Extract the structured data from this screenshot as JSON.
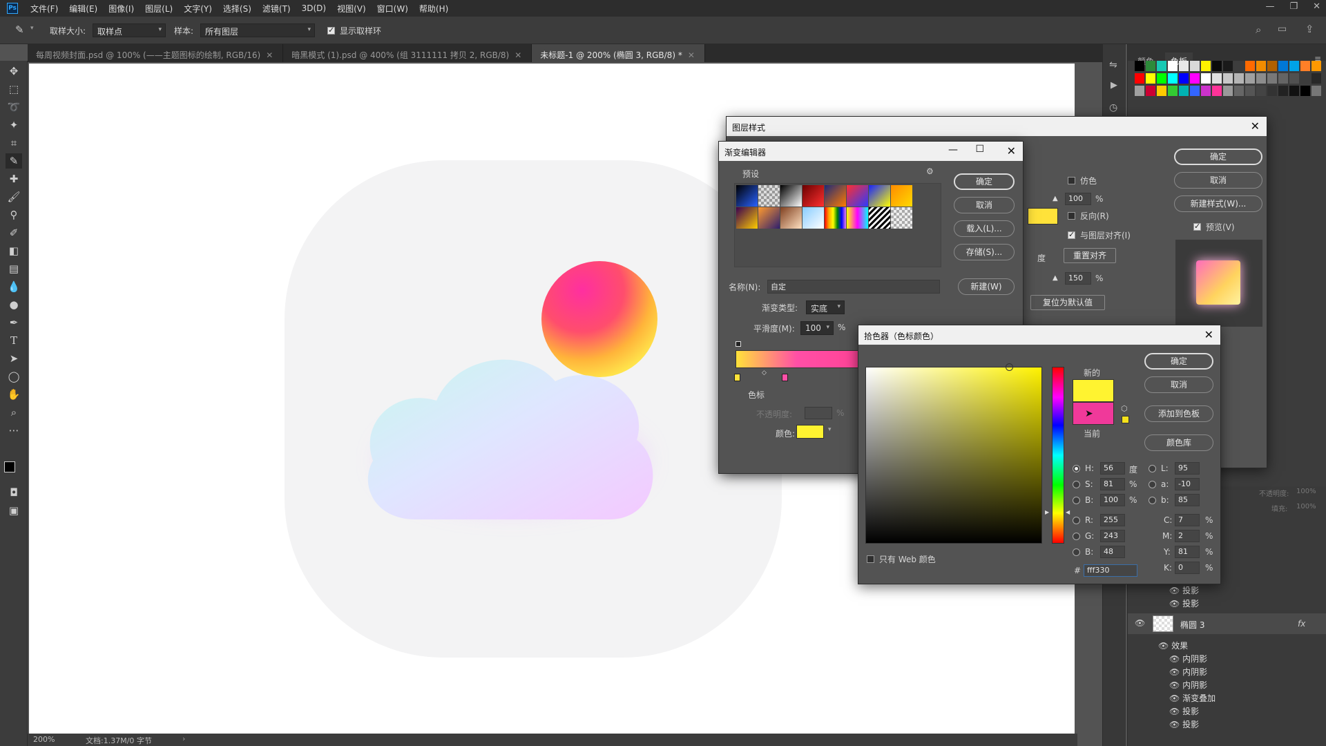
{
  "menubar": {
    "logo": "Ps",
    "items": [
      "文件(F)",
      "编辑(E)",
      "图像(I)",
      "图层(L)",
      "文字(Y)",
      "选择(S)",
      "滤镜(T)",
      "3D(D)",
      "视图(V)",
      "窗口(W)",
      "帮助(H)"
    ]
  },
  "options": {
    "sample_size_label": "取样大小:",
    "sample_size_value": "取样点",
    "sample_label": "样本:",
    "sample_value": "所有图层",
    "show_ring_label": "显示取样环"
  },
  "tabs": [
    {
      "label": "每周视频封面.psd @ 100% (——主题图标的绘制, RGB/16)",
      "active": false
    },
    {
      "label": "暗黑模式 (1).psd @ 400% (组 3111111 拷贝 2, RGB/8)",
      "active": false
    },
    {
      "label": "未标题-1 @ 200% (椭圆 3, RGB/8) *",
      "active": true
    }
  ],
  "status": {
    "zoom": "200%",
    "doc": "文档:1.37M/0 字节"
  },
  "swatches_panel": {
    "tab_color": "颜色",
    "tab_swatches": "色板",
    "row1": [
      "#000000",
      "#2d8a3a",
      "#18c9b4",
      "#ffffff",
      "#e8e8e8",
      "#d9d9d9",
      "#fff200",
      "#0b0b0b",
      "#1a1a1a",
      "#3d3d3d",
      "#ff6a00",
      "#f28c00",
      "#b06000",
      "#0078d7",
      "#00a2e8",
      "#ff7f27",
      "#ff9800"
    ],
    "row2": [
      "#ff0000",
      "#ffff00",
      "#00ff00",
      "#00ffff",
      "#0000ff",
      "#ff00ff",
      "#ffffff",
      "#e0e0e0",
      "#c8c8c8",
      "#b4b4b4",
      "#a0a0a0",
      "#8c8c8c",
      "#787878",
      "#646464",
      "#505050",
      "#3c3c3c",
      "#282828"
    ],
    "row3": [
      "#a0a0a0",
      "#cc0033",
      "#ffcc00",
      "#33cc33",
      "#00b3b3",
      "#3366ff",
      "#cc33cc",
      "#ff3399",
      "#999999",
      "#666666",
      "#555555",
      "#444444",
      "#333333",
      "#222222",
      "#111111",
      "#000000",
      "#777777"
    ]
  },
  "layer_style": {
    "title": "图层样式",
    "ok": "确定",
    "cancel": "取消",
    "new_style": "新建样式(W)...",
    "preview": "预览(V)",
    "dither": "仿色",
    "opacity_value": "100",
    "pct": "%",
    "reverse": "反向(R)",
    "align_layer": "与图层对齐(I)",
    "degree": "度",
    "reset_align": "重置对齐",
    "scale_value": "150",
    "reset_default": "复位为默认值"
  },
  "gradient_editor": {
    "title": "渐变编辑器",
    "presets": "预设",
    "ok": "确定",
    "cancel": "取消",
    "load": "载入(L)...",
    "save": "存储(S)...",
    "name_label": "名称(N):",
    "name_value": "自定",
    "new": "新建(W)",
    "type_label": "渐变类型:",
    "type_value": "实底",
    "smooth_label": "平滑度(M):",
    "smooth_value": "100",
    "pct": "%",
    "stops": "色标",
    "opacity": "不透明度:",
    "color": "颜色:"
  },
  "color_picker": {
    "title": "拾色器（色标颜色）",
    "ok": "确定",
    "cancel": "取消",
    "add_swatch": "添加到色板",
    "libraries": "颜色库",
    "new_label": "新的",
    "current_label": "当前",
    "new_color": "#fff330",
    "current_color": "#f0399a",
    "web_only": "只有 Web 颜色",
    "hsb": [
      {
        "k": "H:",
        "v": "56",
        "u": "度"
      },
      {
        "k": "S:",
        "v": "81",
        "u": "%"
      },
      {
        "k": "B:",
        "v": "100",
        "u": "%"
      }
    ],
    "rgb": [
      {
        "k": "R:",
        "v": "255"
      },
      {
        "k": "G:",
        "v": "243"
      },
      {
        "k": "B:",
        "v": "48"
      }
    ],
    "lab": [
      {
        "k": "L:",
        "v": "95"
      },
      {
        "k": "a:",
        "v": "-10"
      },
      {
        "k": "b:",
        "v": "85"
      }
    ],
    "cmyk": [
      {
        "k": "C:",
        "v": "7",
        "u": "%"
      },
      {
        "k": "M:",
        "v": "2",
        "u": "%"
      },
      {
        "k": "Y:",
        "v": "81",
        "u": "%"
      },
      {
        "k": "K:",
        "v": "0",
        "u": "%"
      }
    ],
    "hash": "#",
    "hex": "fff330"
  },
  "layers_panel": {
    "fill_label": "填充:",
    "fill_value": "100%",
    "opacity_label": "不透明度:",
    "opacity_value": "100%",
    "upper_effects": [
      "投影",
      "投影"
    ],
    "layer_name": "椭圆 3",
    "fx": "fx",
    "effects_label": "效果",
    "effects": [
      "内阴影",
      "内阴影",
      "内阴影",
      "渐变叠加",
      "投影",
      "投影"
    ]
  }
}
